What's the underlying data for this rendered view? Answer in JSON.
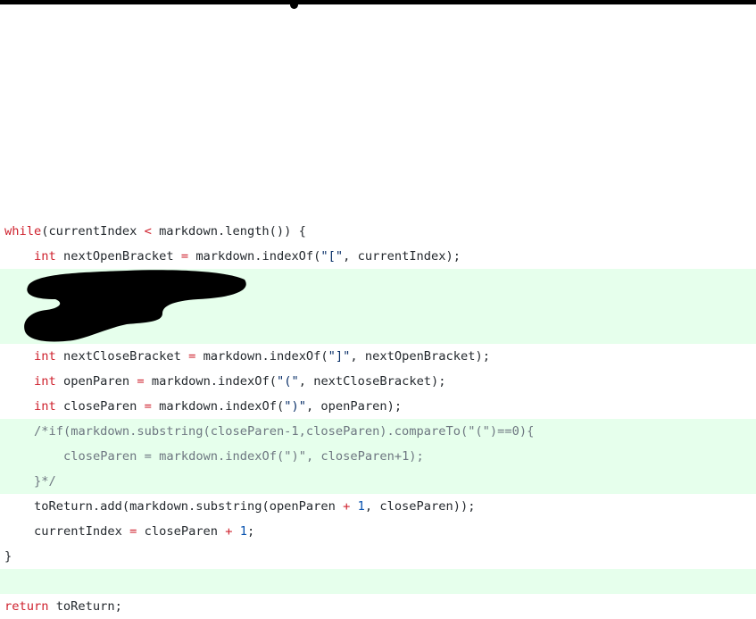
{
  "colors": {
    "added_bg": "#e6ffec",
    "keyword": "#cf222e",
    "number": "#0550ae",
    "string": "#0a3069",
    "comment": "#6e7781"
  },
  "code": {
    "lines": [
      {
        "added": false,
        "indent": 0,
        "tokens": [
          [
            "kw",
            "while"
          ],
          [
            "pl",
            "(currentIndex "
          ],
          [
            "op",
            "<"
          ],
          [
            "pl",
            " markdown.length()) {"
          ]
        ]
      },
      {
        "added": false,
        "indent": 1,
        "tokens": [
          [
            "kw",
            "int"
          ],
          [
            "pl",
            " nextOpenBracket "
          ],
          [
            "op",
            "="
          ],
          [
            "pl",
            " markdown.indexOf("
          ],
          [
            "str",
            "\"[\""
          ],
          [
            "pl",
            ", currentIndex);"
          ]
        ]
      },
      {
        "added": true,
        "indent": 1,
        "redacted": true,
        "tokens": []
      },
      {
        "added": true,
        "indent": 1,
        "redacted": true,
        "tokens": []
      },
      {
        "added": true,
        "indent": 1,
        "redacted": true,
        "tokens": []
      },
      {
        "added": false,
        "indent": 1,
        "tokens": [
          [
            "kw",
            "int"
          ],
          [
            "pl",
            " nextCloseBracket "
          ],
          [
            "op",
            "="
          ],
          [
            "pl",
            " markdown.indexOf("
          ],
          [
            "str",
            "\"]\""
          ],
          [
            "pl",
            ", nextOpenBracket);"
          ]
        ]
      },
      {
        "added": false,
        "indent": 1,
        "tokens": [
          [
            "kw",
            "int"
          ],
          [
            "pl",
            " openParen "
          ],
          [
            "op",
            "="
          ],
          [
            "pl",
            " markdown.indexOf("
          ],
          [
            "str",
            "\"(\""
          ],
          [
            "pl",
            ", nextCloseBracket);"
          ]
        ]
      },
      {
        "added": false,
        "indent": 1,
        "tokens": [
          [
            "kw",
            "int"
          ],
          [
            "pl",
            " closeParen "
          ],
          [
            "op",
            "="
          ],
          [
            "pl",
            " markdown.indexOf("
          ],
          [
            "str",
            "\")\""
          ],
          [
            "pl",
            ", openParen);"
          ]
        ]
      },
      {
        "added": true,
        "indent": 1,
        "tokens": [
          [
            "cm",
            "/*if(markdown.substring(closeParen-1,closeParen).compareTo(\"(\")==0){"
          ]
        ]
      },
      {
        "added": true,
        "indent": 2,
        "tokens": [
          [
            "cm",
            "closeParen = markdown.indexOf(\")\", closeParen+1);"
          ]
        ]
      },
      {
        "added": true,
        "indent": 1,
        "tokens": [
          [
            "cm",
            "}*/"
          ]
        ]
      },
      {
        "added": false,
        "indent": 1,
        "tokens": [
          [
            "pl",
            "toReturn.add(markdown.substring(openParen "
          ],
          [
            "op",
            "+"
          ],
          [
            "pl",
            " "
          ],
          [
            "num",
            "1"
          ],
          [
            "pl",
            ", closeParen));"
          ]
        ]
      },
      {
        "added": false,
        "indent": 1,
        "tokens": [
          [
            "pl",
            "currentIndex "
          ],
          [
            "op",
            "="
          ],
          [
            "pl",
            " closeParen "
          ],
          [
            "op",
            "+"
          ],
          [
            "pl",
            " "
          ],
          [
            "num",
            "1"
          ],
          [
            "pl",
            ";"
          ]
        ]
      },
      {
        "added": false,
        "indent": 0,
        "tokens": [
          [
            "pl",
            "}"
          ]
        ]
      },
      {
        "added": true,
        "indent": 0,
        "tokens": []
      },
      {
        "added": false,
        "indent": 0,
        "tokens": [
          [
            "kw",
            "return"
          ],
          [
            "pl",
            " toReturn;"
          ]
        ]
      }
    ]
  }
}
